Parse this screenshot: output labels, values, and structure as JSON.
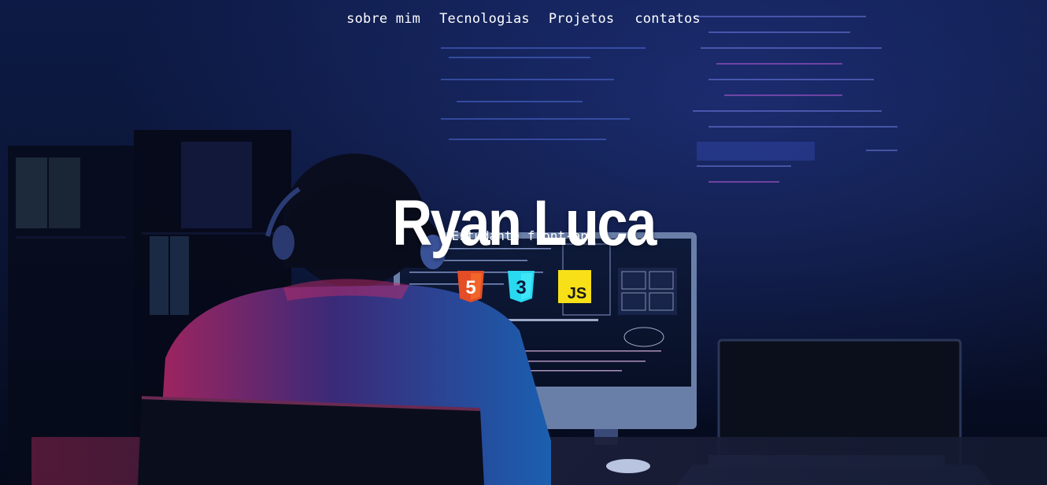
{
  "nav": {
    "items": [
      "sobre mim",
      "Tecnologias",
      "Projetos",
      "contatos"
    ]
  },
  "hero": {
    "name": "Ryan Luca",
    "role": "Estudante front-and"
  },
  "technologies": [
    {
      "icon": "html5-icon",
      "label": "5",
      "color": "#e44d26"
    },
    {
      "icon": "css3-icon",
      "label": "3",
      "color": "#29d9f0"
    },
    {
      "icon": "javascript-icon",
      "label": "JS",
      "color": "#f7e018"
    }
  ],
  "colors": {
    "background": "#0b1638",
    "text": "#ffffff"
  }
}
